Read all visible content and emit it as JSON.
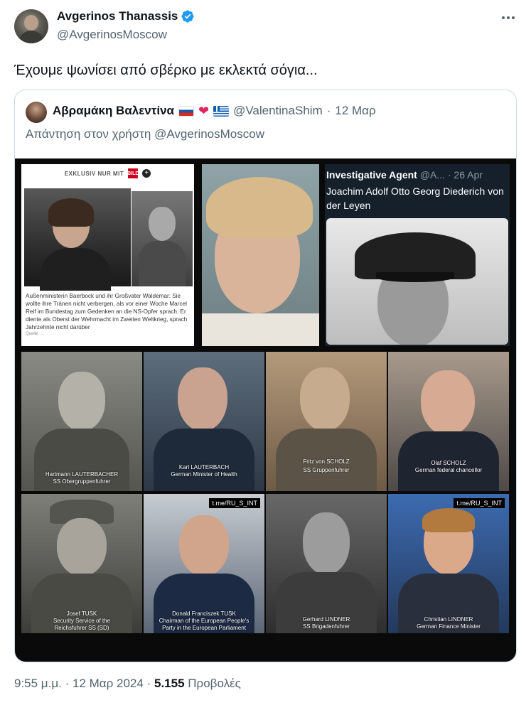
{
  "author": {
    "display_name": "Avgerinos Thanassis",
    "handle": "@AvgerinosMoscow",
    "verified": true,
    "icons": [
      "avatar",
      "verified-badge-icon",
      "more-options-icon"
    ]
  },
  "tweet": {
    "text": "Έχουμε ψωνίσει από σβέρκο με εκλεκτά σόγια..."
  },
  "quoted_tweet": {
    "display_name": "Αβραμάκη Βαλεντίνα",
    "handle": "@ValentinaShim",
    "separator": "·",
    "date": "12 Μαρ",
    "reply_prefix": "Απάντηση στον χρήστη",
    "reply_to": "@AvgerinosMoscow",
    "colors": {
      "heart": "#e0245e"
    },
    "collage": {
      "bild": {
        "label": "EXKLUSIV NUR MIT",
        "logo": "BILD",
        "plus": "+",
        "caption": "Außenministerin Baerbock und ihr Großvater Waldemar: Sie wollte ihre Tränen nicht verbergen, als vor einer Woche Marcel Reif im Bundestag zum Gedenken an die NS-Opfer sprach. Er diente als Oberst der Wehrmacht im Zweiten Weltkrieg, sprach Jahrzehnte nicht darüber",
        "source": "Quelle: ..."
      },
      "investigative": {
        "name": "Investigative Agent",
        "handle": "@A...",
        "separator": "·",
        "date": "26 Apr",
        "text": "Joachim Adolf Otto Georg Diederich von der Leyen"
      },
      "cells": [
        {
          "caption": [
            "Hartmann LAUTERBACHER",
            "SS Obergruppenfuhrer"
          ],
          "tme": ""
        },
        {
          "caption": [
            "Karl LAUTERBACH",
            "German Minister of Health"
          ],
          "tme": ""
        },
        {
          "caption": [
            "Fritz von SCHOLZ",
            "SS Gruppenfuhrer"
          ],
          "tme": ""
        },
        {
          "caption": [
            "Olaf SCHOLZ",
            "German federal chancellor"
          ],
          "tme": ""
        },
        {
          "caption": [
            "Josef TUSK",
            "Security Service of the",
            "Reichsfuhrer SS (SD)"
          ],
          "tme": ""
        },
        {
          "caption": [
            "Donald Franciszek TUSK",
            "Chairman of the European People's",
            "Party in the European Parliament"
          ],
          "tme": "t.me/RU_S_INT"
        },
        {
          "caption": [
            "Gerhard LINDNER",
            "SS Brigadenfuhrer"
          ],
          "tme": ""
        },
        {
          "caption": [
            "Christian LINDNER",
            "German Finance Minister"
          ],
          "tme": "t.me/RU_S_INT"
        }
      ]
    }
  },
  "footer": {
    "time": "9:55 μ.μ.",
    "separator": "·",
    "date": "12 Μαρ 2024",
    "separator2": "·",
    "views_count": "5.155",
    "views_label": "Προβολές"
  }
}
